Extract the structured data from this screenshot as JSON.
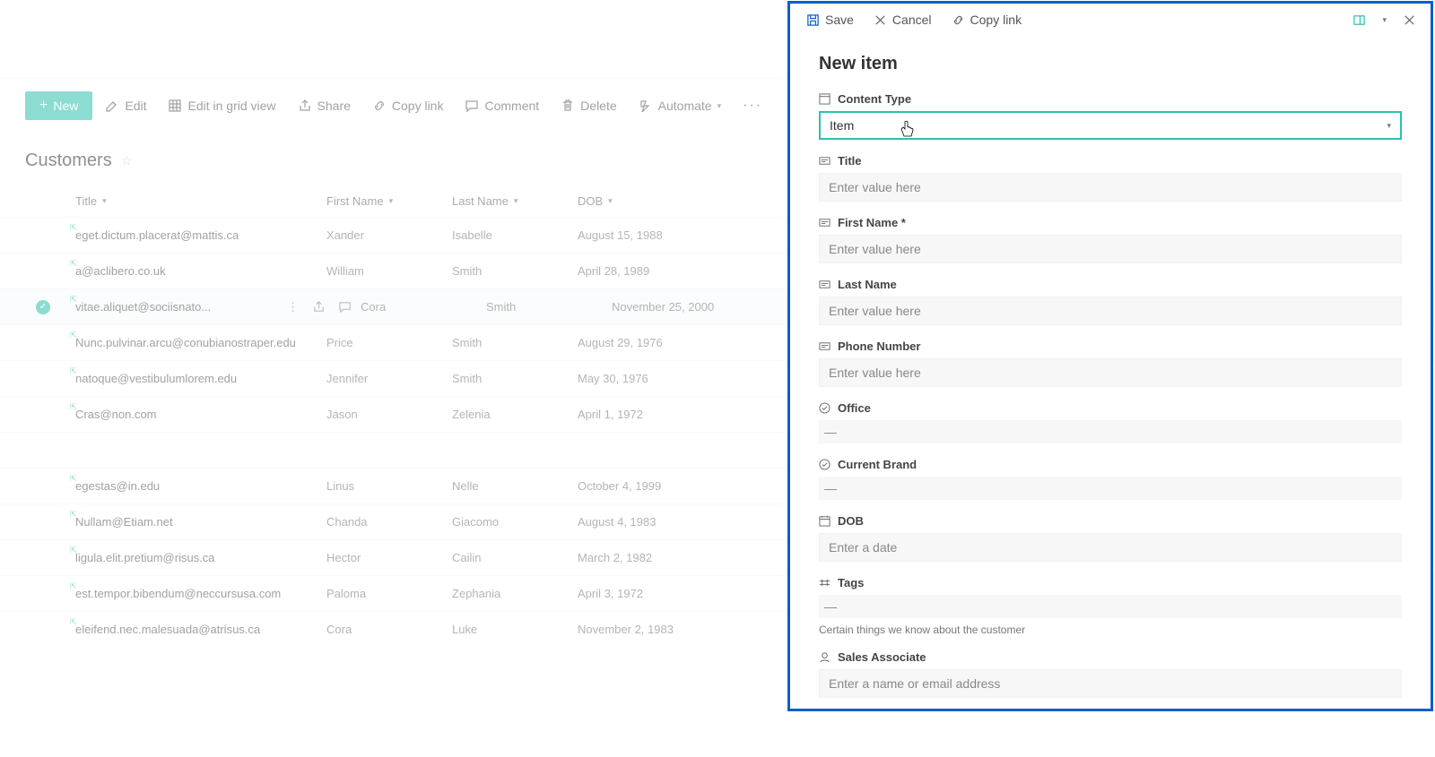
{
  "toolbar": {
    "new": "New",
    "edit": "Edit",
    "grid": "Edit in grid view",
    "share": "Share",
    "copy": "Copy link",
    "comment": "Comment",
    "delete": "Delete",
    "automate": "Automate"
  },
  "list": {
    "title": "Customers",
    "columns": {
      "title": "Title",
      "fn": "First Name",
      "ln": "Last Name",
      "dob": "DOB"
    },
    "rows": [
      {
        "title": "eget.dictum.placerat@mattis.ca",
        "fn": "Xander",
        "ln": "Isabelle",
        "dob": "August 15, 1988"
      },
      {
        "title": "a@aclibero.co.uk",
        "fn": "William",
        "ln": "Smith",
        "dob": "April 28, 1989"
      },
      {
        "title": "vitae.aliquet@sociisnato...",
        "fn": "Cora",
        "ln": "Smith",
        "dob": "November 25, 2000",
        "selected": true
      },
      {
        "title": "Nunc.pulvinar.arcu@conubianostraper.edu",
        "fn": "Price",
        "ln": "Smith",
        "dob": "August 29, 1976"
      },
      {
        "title": "natoque@vestibulumlorem.edu",
        "fn": "Jennifer",
        "ln": "Smith",
        "dob": "May 30, 1976"
      },
      {
        "title": "Cras@non.com",
        "fn": "Jason",
        "ln": "Zelenia",
        "dob": "April 1, 1972"
      },
      {
        "spacer": true
      },
      {
        "title": "egestas@in.edu",
        "fn": "Linus",
        "ln": "Nelle",
        "dob": "October 4, 1999"
      },
      {
        "title": "Nullam@Etiam.net",
        "fn": "Chanda",
        "ln": "Giacomo",
        "dob": "August 4, 1983"
      },
      {
        "title": "ligula.elit.pretium@risus.ca",
        "fn": "Hector",
        "ln": "Cailin",
        "dob": "March 2, 1982"
      },
      {
        "title": "est.tempor.bibendum@neccursusa.com",
        "fn": "Paloma",
        "ln": "Zephania",
        "dob": "April 3, 1972"
      },
      {
        "title": "eleifend.nec.malesuada@atrisus.ca",
        "fn": "Cora",
        "ln": "Luke",
        "dob": "November 2, 1983"
      }
    ]
  },
  "panel": {
    "tb": {
      "save": "Save",
      "cancel": "Cancel",
      "copy": "Copy link"
    },
    "title": "New item",
    "contentType": {
      "label": "Content Type",
      "value": "Item"
    },
    "fields": {
      "title": {
        "label": "Title",
        "ph": "Enter value here"
      },
      "firstName": {
        "label": "First Name *",
        "ph": "Enter value here"
      },
      "lastName": {
        "label": "Last Name",
        "ph": "Enter value here"
      },
      "phone": {
        "label": "Phone Number",
        "ph": "Enter value here"
      },
      "office": {
        "label": "Office",
        "empty": "—"
      },
      "brand": {
        "label": "Current Brand",
        "empty": "—"
      },
      "dob": {
        "label": "DOB",
        "ph": "Enter a date"
      },
      "tags": {
        "label": "Tags",
        "empty": "—",
        "helper": "Certain things we know about the customer"
      },
      "sales": {
        "label": "Sales Associate",
        "ph": "Enter a name or email address"
      }
    }
  }
}
